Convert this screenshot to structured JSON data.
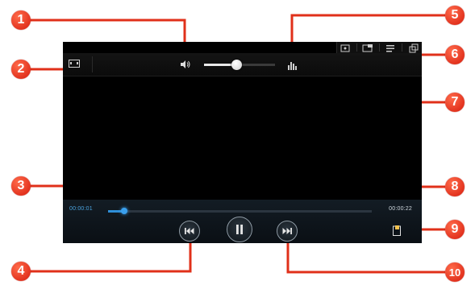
{
  "player": {
    "elapsed": "00:00:01",
    "total": "00:00:22",
    "progress_fraction": 0.06,
    "volume_fraction": 0.45
  },
  "icons": {
    "aspect": "screen-mode-icon",
    "volume": "volume-icon",
    "equalizer": "equalizer-icon",
    "top_right": [
      "allshare-icon",
      "popup-play-icon",
      "playlist-icon",
      "multi-window-icon"
    ],
    "rewind": "rewind-icon",
    "pause": "pause-icon",
    "forward": "fast-forward-icon",
    "capture": "capture-icon"
  },
  "callouts": [
    "1",
    "2",
    "3",
    "4",
    "5",
    "6",
    "7",
    "8",
    "9",
    "10"
  ],
  "colors": {
    "callout": "#e0301a",
    "accent": "#2f8fd8"
  }
}
